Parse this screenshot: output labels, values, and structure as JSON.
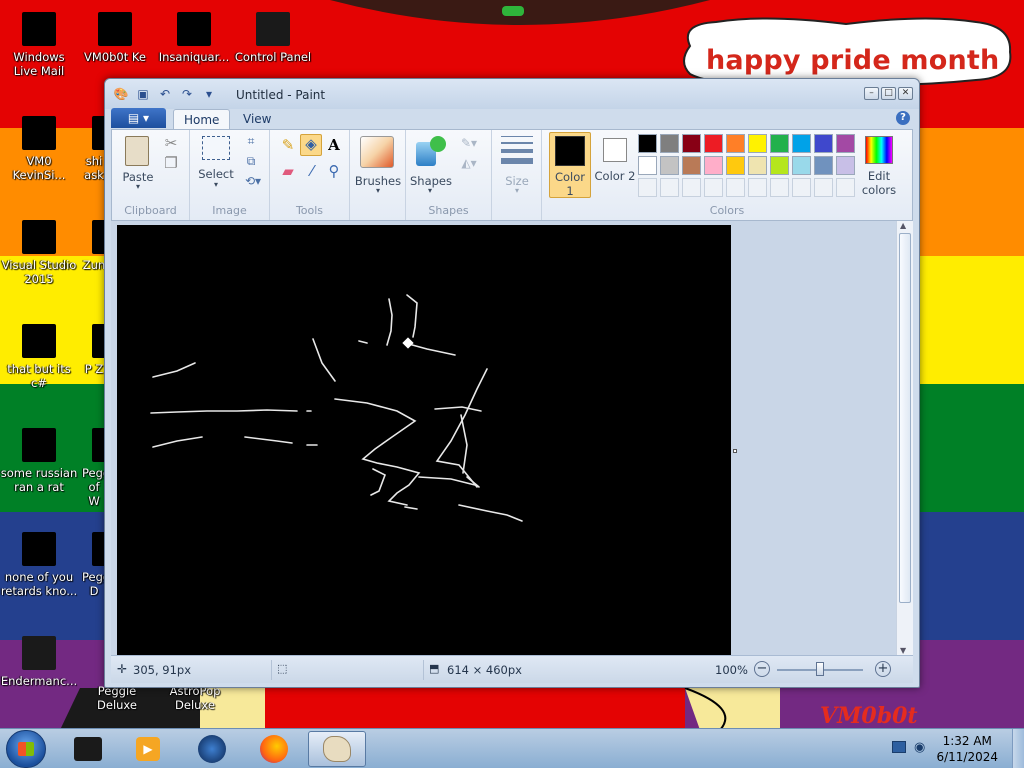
{
  "desktop": {
    "icons": [
      {
        "label": "Windows Live Mail"
      },
      {
        "label": "VM0b0t Ke"
      },
      {
        "label": "Insaniquar..."
      },
      {
        "label": "Control Panel"
      },
      {
        "label": "VM0 KevinSi..."
      },
      {
        "label": "shi ask"
      },
      {
        "label": "Visual Studio 2015"
      },
      {
        "label": "Zun"
      },
      {
        "label": "that but its c#"
      },
      {
        "label": "P Z"
      },
      {
        "label": "some russian ran a rat"
      },
      {
        "label": "Pegg of W"
      },
      {
        "label": "none of you retards kno..."
      },
      {
        "label": "Pegg D"
      },
      {
        "label": "Endermanc..."
      },
      {
        "label": "Peggle Deluxe"
      },
      {
        "label": "AstroPop Deluxe"
      }
    ],
    "bubble_text": "happy pride month",
    "logo_text": "VM0b0t",
    "stripe_colors": [
      "#e40303",
      "#ff8c00",
      "#ffed00",
      "#008026",
      "#24408e",
      "#732982"
    ]
  },
  "paint": {
    "title": "Untitled - Paint",
    "file_tab": "",
    "tabs": [
      "Home",
      "View"
    ],
    "groups": {
      "clipboard": {
        "label": "Clipboard",
        "paste": "Paste"
      },
      "image": {
        "label": "Image",
        "select": "Select"
      },
      "tools": {
        "label": "Tools"
      },
      "brushes": {
        "label": "Brushes"
      },
      "shapes": {
        "label": "Shapes",
        "shapes_btn": "Shapes"
      },
      "size": {
        "label": "Size"
      },
      "colors": {
        "label": "Colors",
        "color1": "Color 1",
        "color1_num": "1",
        "color2": "Color 2",
        "color2_num": "2",
        "edit": "Edit colors",
        "color1_value": "#000000",
        "color2_value": "#ffffff",
        "palette_row1": [
          "#000000",
          "#7f7f7f",
          "#880015",
          "#ed1c24",
          "#ff7f27",
          "#fff200",
          "#22b14c",
          "#00a2e8",
          "#3f48cc",
          "#a349a4"
        ],
        "palette_row2": [
          "#ffffff",
          "#c3c3c3",
          "#b97a57",
          "#ffaec9",
          "#ffc90e",
          "#efe4b0",
          "#b5e61d",
          "#99d9ea",
          "#7092be",
          "#c8bfe7"
        ]
      }
    },
    "status": {
      "cursor_pos": "305, 91px",
      "canvas_size": "614 × 460px",
      "zoom": "100%"
    }
  },
  "taskbar": {
    "time": "1:32 AM",
    "date": "6/11/2024"
  }
}
